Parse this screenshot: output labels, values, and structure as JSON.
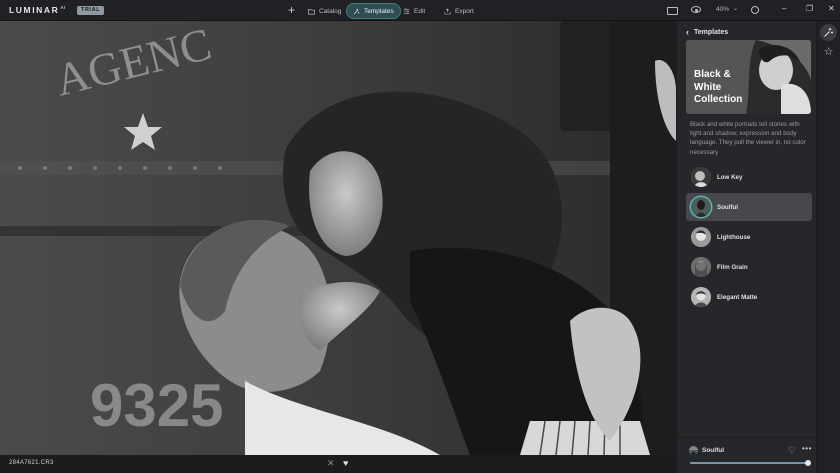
{
  "app": {
    "logo": "LUMINAR",
    "logo_version": "AI",
    "badge": "TRIAL"
  },
  "topbar": {
    "add_icon": "plus-icon",
    "nav": [
      {
        "label": "Catalog",
        "icon": "folder-icon",
        "active": false
      },
      {
        "label": "Templates",
        "icon": "templates-icon",
        "active": true
      },
      {
        "label": "Edit",
        "icon": "edit-icon",
        "active": false
      },
      {
        "label": "Export",
        "icon": "export-icon",
        "active": false
      }
    ],
    "zoom": "40%",
    "accent_color": "#56b9b5"
  },
  "status": {
    "filename": "284A7621.CR3"
  },
  "panel": {
    "header": "Templates",
    "collection": {
      "title": "Black & White Collection",
      "description": "Black and white portraits tell stories with light and shadow, expression and body language. They pull the viewer in, no color necessary"
    },
    "templates": [
      {
        "label": "Low Key",
        "active": false
      },
      {
        "label": "Soulful",
        "active": true
      },
      {
        "label": "Lighthouse",
        "active": false
      },
      {
        "label": "Film Grain",
        "active": false
      },
      {
        "label": "Elegant Matte",
        "active": false
      }
    ],
    "footer": {
      "selected": "Soulful",
      "amount": 100
    }
  },
  "tools": [
    {
      "icon": "templates-wand-icon",
      "active": true
    },
    {
      "icon": "star-icon",
      "active": false
    }
  ]
}
